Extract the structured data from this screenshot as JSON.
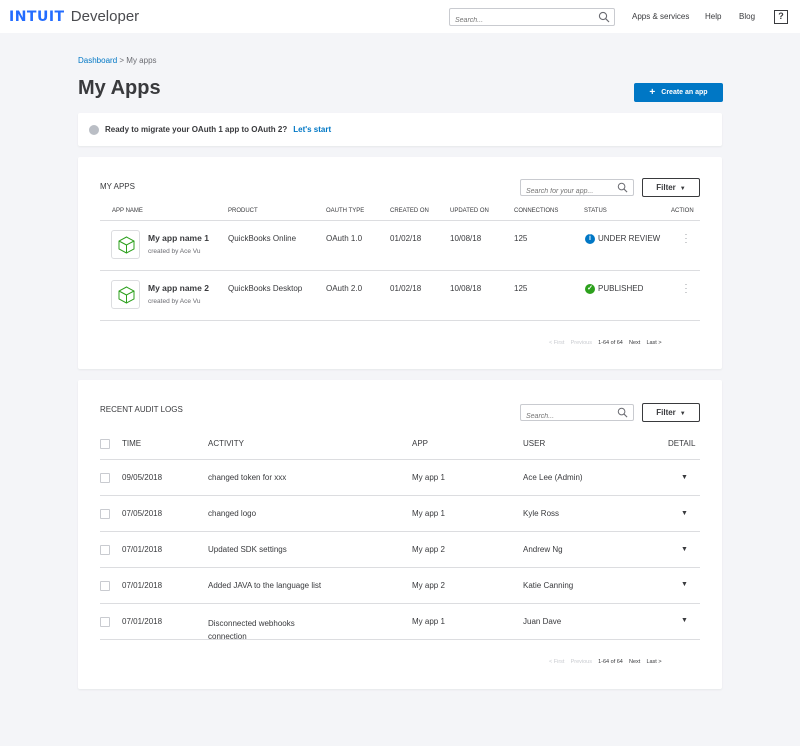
{
  "header": {
    "brand": "INTUIT",
    "product": "Developer",
    "search_placeholder": "Search...",
    "nav": [
      {
        "label": "Apps & services"
      },
      {
        "label": "Help"
      },
      {
        "label": "Blog"
      }
    ],
    "help_icon_label": "?"
  },
  "breadcrumb": {
    "home": "Dashboard",
    "separator": ">",
    "current": "My apps"
  },
  "page": {
    "title": "My Apps",
    "create_button": "Create an app"
  },
  "banner": {
    "message": "Ready to migrate your OAuth 1 app to OAuth 2?",
    "link": "Let's start"
  },
  "my_apps": {
    "title": "MY APPS",
    "search_placeholder": "Search for your app...",
    "filter_label": "Filter",
    "columns": [
      "APP NAME",
      "PRODUCT",
      "OAUTH TYPE",
      "CREATED ON",
      "UPDATED ON",
      "CONNECTIONS",
      "STATUS",
      "ACTION"
    ],
    "rows": [
      {
        "name": "My app name 1",
        "creator": "created by Ace Vu",
        "product": "QuickBooks Online",
        "oauth": "OAuth 1.0",
        "created": "01/02/18",
        "updated": "10/08/18",
        "connections": "125",
        "status": "UNDER REVIEW",
        "status_icon": "info-icon",
        "status_color": "#0077c5"
      },
      {
        "name": "My app name 2",
        "creator": "created by Ace Vu",
        "product": "QuickBooks Desktop",
        "oauth": "OAuth 2.0",
        "created": "01/02/18",
        "updated": "10/08/18",
        "connections": "125",
        "status": "PUBLISHED",
        "status_icon": "check-icon",
        "status_color": "#2ca01c"
      }
    ],
    "pager": {
      "first": "< First",
      "previous": "Previous",
      "range": "1-64 of 64",
      "next": "Next",
      "last": "Last >"
    }
  },
  "audit_logs": {
    "title": "RECENT AUDIT LOGS",
    "search_placeholder": "Search...",
    "filter_label": "Filter",
    "columns": [
      "TIME",
      "ACTIVITY",
      "APP",
      "USER",
      "DETAIL"
    ],
    "rows": [
      {
        "time": "09/05/2018",
        "activity": "changed token for xxx",
        "app": "My app 1",
        "user": "Ace Lee (Admin)"
      },
      {
        "time": "07/05/2018",
        "activity": "changed logo",
        "app": "My app 1",
        "user": "Kyle Ross"
      },
      {
        "time": "07/01/2018",
        "activity": "Updated SDK settings",
        "app": "My app 2",
        "user": "Andrew Ng"
      },
      {
        "time": "07/01/2018",
        "activity": "Added JAVA to the language list",
        "app": "My app 2",
        "user": "Katie Canning"
      },
      {
        "time": "07/01/2018",
        "activity": "Disconnected webhooks connection",
        "app": "My app 1",
        "user": "Juan Dave"
      }
    ],
    "pager": {
      "first": "< First",
      "previous": "Previous",
      "range": "1-64 of 64",
      "next": "Next",
      "last": "Last >"
    }
  },
  "colors": {
    "accent": "#0077c5",
    "success": "#2ca01c",
    "brand": "#236cff"
  }
}
